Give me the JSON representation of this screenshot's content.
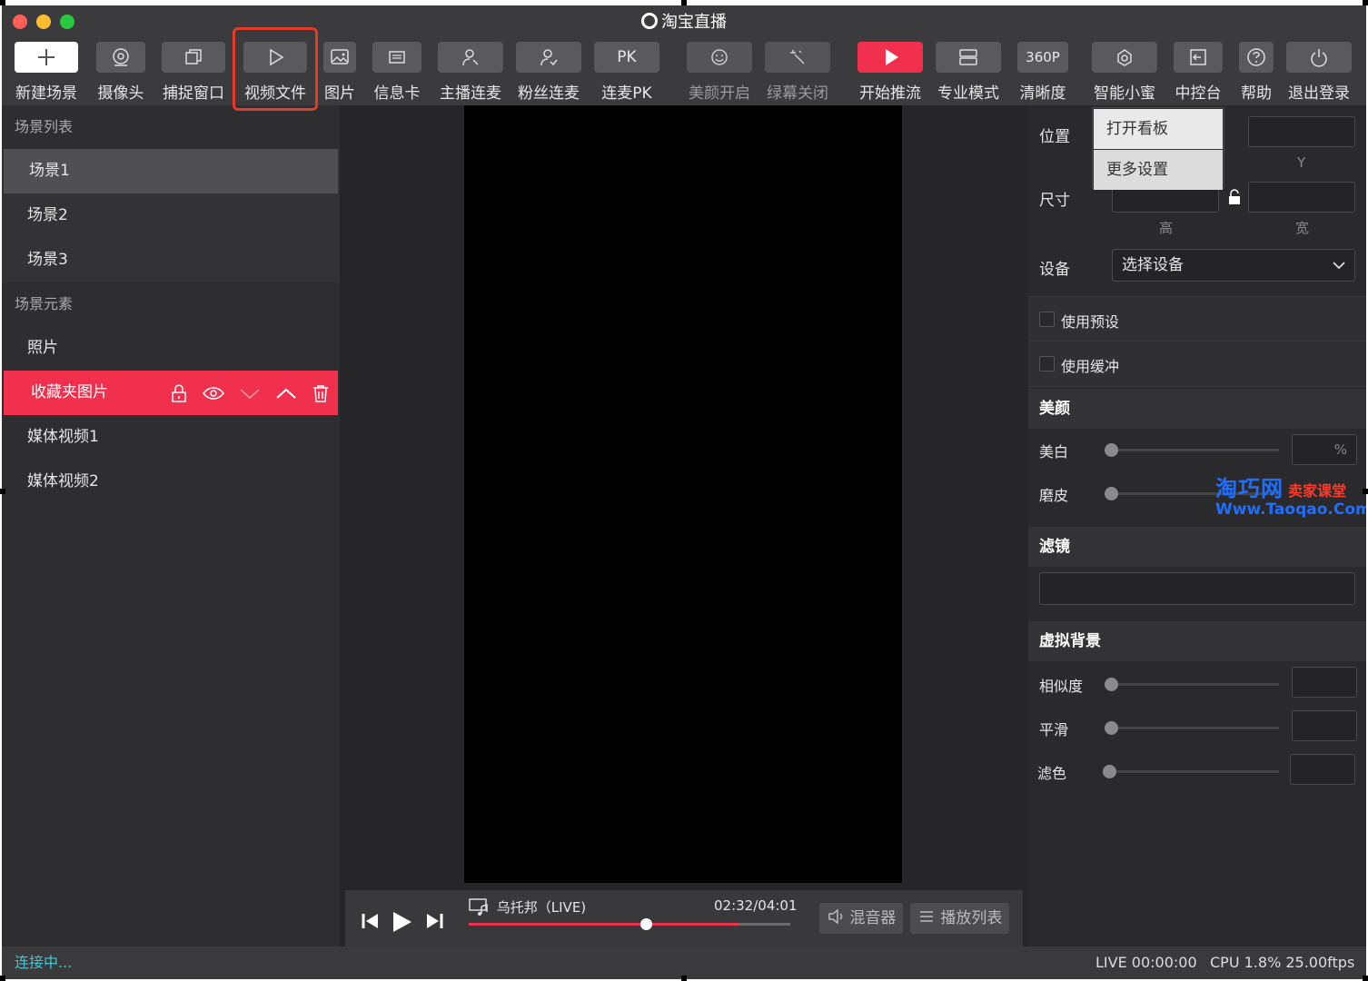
{
  "window": {
    "title": "淘宝直播"
  },
  "toolbar": {
    "new_scene": "新建场景",
    "camera": "摄像头",
    "capture_window": "捕捉窗口",
    "video_file": "视频文件",
    "image": "图片",
    "info_card": "信息卡",
    "host_link": "主播连麦",
    "fan_link": "粉丝连麦",
    "pk_box": "PK",
    "link_pk": "连麦PK",
    "beauty_on": "美颜开启",
    "green_off": "绿幕关闭",
    "start_stream": "开始推流",
    "pro_mode": "专业模式",
    "res_box": "360P",
    "clarity": "清晰度",
    "assistant": "智能小蜜",
    "console": "中控台",
    "help": "帮助",
    "logout": "退出登录"
  },
  "left": {
    "scene_list_title": "场景列表",
    "scenes": [
      "场景1",
      "场景2",
      "场景3"
    ],
    "elements_title": "场景元素",
    "elements": [
      "照片",
      "收藏夹图片",
      "媒体视频1",
      "媒体视频2"
    ]
  },
  "player": {
    "song": "乌托邦（LIVE)",
    "time": "02:32/04:01",
    "progress": 0.55,
    "buffer": 0.84,
    "mixer": "混音器",
    "playlist": "播放列表"
  },
  "right": {
    "position_label": "位置",
    "y_label": "Y",
    "size_label": "尺寸",
    "height_label": "高",
    "width_label": "宽",
    "device_label": "设备",
    "device_value": "选择设备",
    "use_preset": "使用预设",
    "use_buffer": "使用缓冲",
    "beauty_title": "美颜",
    "whiten": "美白",
    "percent": "%",
    "smooth_skin": "磨皮",
    "filter_title": "滤镜",
    "vbg_title": "虚拟背景",
    "similarity": "相似度",
    "smooth": "平滑",
    "color_filter": "滤色"
  },
  "menu": {
    "open_board": "打开看板",
    "more_settings": "更多设置"
  },
  "watermark": {
    "brand": "淘巧网",
    "tag": "卖家课堂",
    "url": "Www.Taoqao.Com"
  },
  "status": {
    "connecting": "连接中...",
    "live": "LIVE 00:00:00",
    "cpu": "CPU 1.8% 25.00ftps"
  },
  "colors": {
    "accent": "#f0304d",
    "highlight_box": "#e33a2a",
    "status_text": "#3fc7d6"
  }
}
